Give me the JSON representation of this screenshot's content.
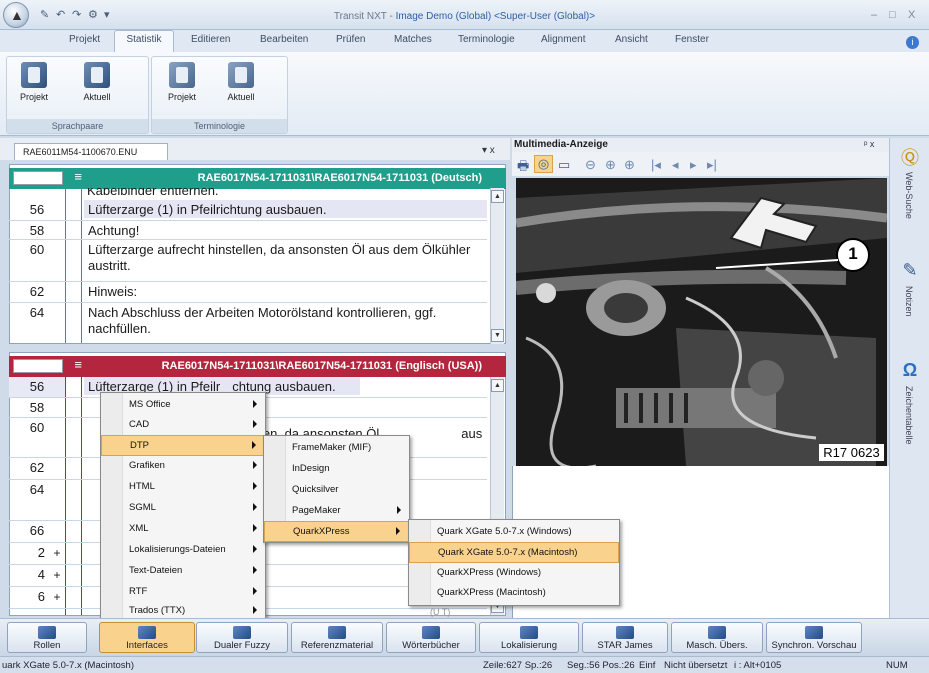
{
  "window": {
    "title_prefix": "Transit NXT - ",
    "title_highlight": "Image Demo (Global) <Super-User (Global)>",
    "minimize": "–",
    "maximize": "□",
    "close": "X"
  },
  "quick_access": {
    "icons": [
      "save-icon",
      "undo-icon",
      "redo-icon",
      "dropdown-icon"
    ],
    "dropdown": "▾"
  },
  "ribbon": {
    "tabs": [
      "Projekt",
      "Statistik",
      "Editieren",
      "Bearbeiten",
      "Prüfen",
      "Matches",
      "Terminologie",
      "Alignment",
      "Ansicht",
      "Fenster"
    ],
    "active_tab": "Statistik",
    "help": "i",
    "groups": [
      {
        "label": "Sprachpaare",
        "buttons": [
          "Projekt",
          "Aktuell"
        ]
      },
      {
        "label": "Terminologie",
        "buttons": [
          "Projekt",
          "Aktuell"
        ]
      }
    ]
  },
  "doc_tab": {
    "label": "RAE6011M54-1100670.ENU",
    "pin": "▾ x"
  },
  "source_pane": {
    "header": "RAE6017N54-1711031\\RAE6017N54-1711031 (Deutsch)",
    "cut_text": "Kabelbinder entfernen.",
    "rows": [
      {
        "num": "56",
        "text": "Lüfterzarge (1) in Pfeilrichtung ausbauen."
      },
      {
        "num": "58",
        "text": "Achtung!"
      },
      {
        "num": "60",
        "text": "Lüfterzarge aufrecht hinstellen, da ansonsten Öl aus dem Ölkühler austritt."
      },
      {
        "num": "62",
        "text": "Hinweis:"
      },
      {
        "num": "64",
        "text": "Nach Abschluss der Arbeiten Motorölstand kontrollieren, ggf. nachfüllen."
      }
    ]
  },
  "target_pane": {
    "header": "RAE6017N54-1711031\\RAE6017N54-1711031 (Englisch (USA))",
    "row1_a": "Lüfterzarge (1) in Pfeilr",
    "row1_b": "chtung ausbauen.",
    "row3_a": "len, da ansonsten Öl",
    "row3_b": "aus dem",
    "row_nums": [
      "56",
      "58",
      "60",
      "62",
      "64",
      "66",
      "2",
      "4",
      "6"
    ],
    "row_plus": "+",
    "bottom_text": "(U T)"
  },
  "multimedia": {
    "title": "Multimedia-Anzeige",
    "pin": "ᵖ x",
    "toolbar": [
      "🖶",
      "◎",
      "▭",
      "⊖",
      "⊕",
      "⊕",
      "|◂",
      "◂",
      "▸",
      "▸|"
    ],
    "callout": "1",
    "ref": "R17 0623"
  },
  "right_bar": [
    {
      "icon": "Ⓠ",
      "label": "Web-Suche"
    },
    {
      "icon": "✎",
      "label": "Notizen"
    },
    {
      "icon": "Ω",
      "label": "Zeichentabelle"
    }
  ],
  "context_menu": {
    "items": [
      "MS Office",
      "CAD",
      "DTP",
      "Grafiken",
      "HTML",
      "SGML",
      "XML",
      "Lokalisierungs-Dateien",
      "Text-Dateien",
      "RTF",
      "Trados (TTX)"
    ],
    "active": "DTP"
  },
  "dtp_menu": {
    "items": [
      "FrameMaker (MIF)",
      "InDesign",
      "Quicksilver",
      "PageMaker",
      "QuarkXPress"
    ],
    "active": "QuarkXPress"
  },
  "quark_menu": {
    "items": [
      "Quark XGate 5.0-7.x (Windows)",
      "Quark XGate 5.0-7.x (Macintosh)",
      "QuarkXPress (Windows)",
      "QuarkXPress (Macintosh)"
    ],
    "active": "Quark XGate 5.0-7.x (Macintosh)"
  },
  "taskbar": [
    "Rollen",
    "Interfaces",
    "Dualer Fuzzy",
    "Referenzmaterial",
    "Wörterbücher",
    "Lokalisierung",
    "STAR James",
    "Masch. Übers.",
    "Synchron. Vorschau"
  ],
  "statusbar": {
    "left": "uark XGate 5.0-7.x (Macintosh)",
    "zeile": "Zeile:627 Sp.:26",
    "seg": "Seg.:56 Pos.:26",
    "einf": "Einf",
    "status": "Nicht übersetzt",
    "key": "i : Alt+0105",
    "num": "NUM"
  },
  "colors": {
    "source_header": "#1f9e8c",
    "target_header": "#b3263d",
    "menu_highlight": "#f9d38e",
    "title_highlight": "#2d5ea8"
  }
}
